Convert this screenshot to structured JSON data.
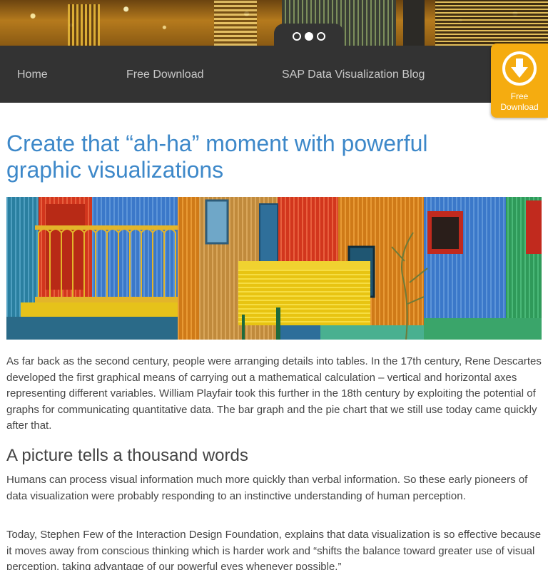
{
  "hero": {
    "carousel_dots": 3,
    "active_dot": 2
  },
  "nav": {
    "home": "Home",
    "free_download": "Free Download",
    "blog": "SAP Data Visualization Blog"
  },
  "badge": {
    "icon": "download-arrow-icon",
    "line1": "Free",
    "line2": "Download"
  },
  "colors": {
    "accent": "#3d88c9",
    "navbar": "#333333",
    "badge": "#f5ac10",
    "body_text": "#444444"
  },
  "article": {
    "headline": "Create that “ah-ha” moment with powerful graphic visualizations",
    "p1": "As far back as the second century, people were arranging details into tables. In the 17th century, Rene Descartes developed the first graphical means of carrying out a mathematical calculation – vertical and horizontal axes representing different variables. William Playfair took this further in the 18th century by exploiting the potential of graphs for communicating quantitative data. The bar graph and the pie chart that we still use today came quickly after that.",
    "subheading": "A picture tells a thousand words",
    "p2": "Humans can process visual information much more quickly than verbal information. So these early pioneers of data visualization were probably responding to an instinctive understanding of human perception.",
    "p3": "Today, Stephen Few of the Interaction Design Foundation, explains that data visualization is so effective because it moves away from conscious thinking which is harder work and “shifts the balance toward greater use of visual perception, taking advantage of our powerful eyes whenever possible.”"
  }
}
